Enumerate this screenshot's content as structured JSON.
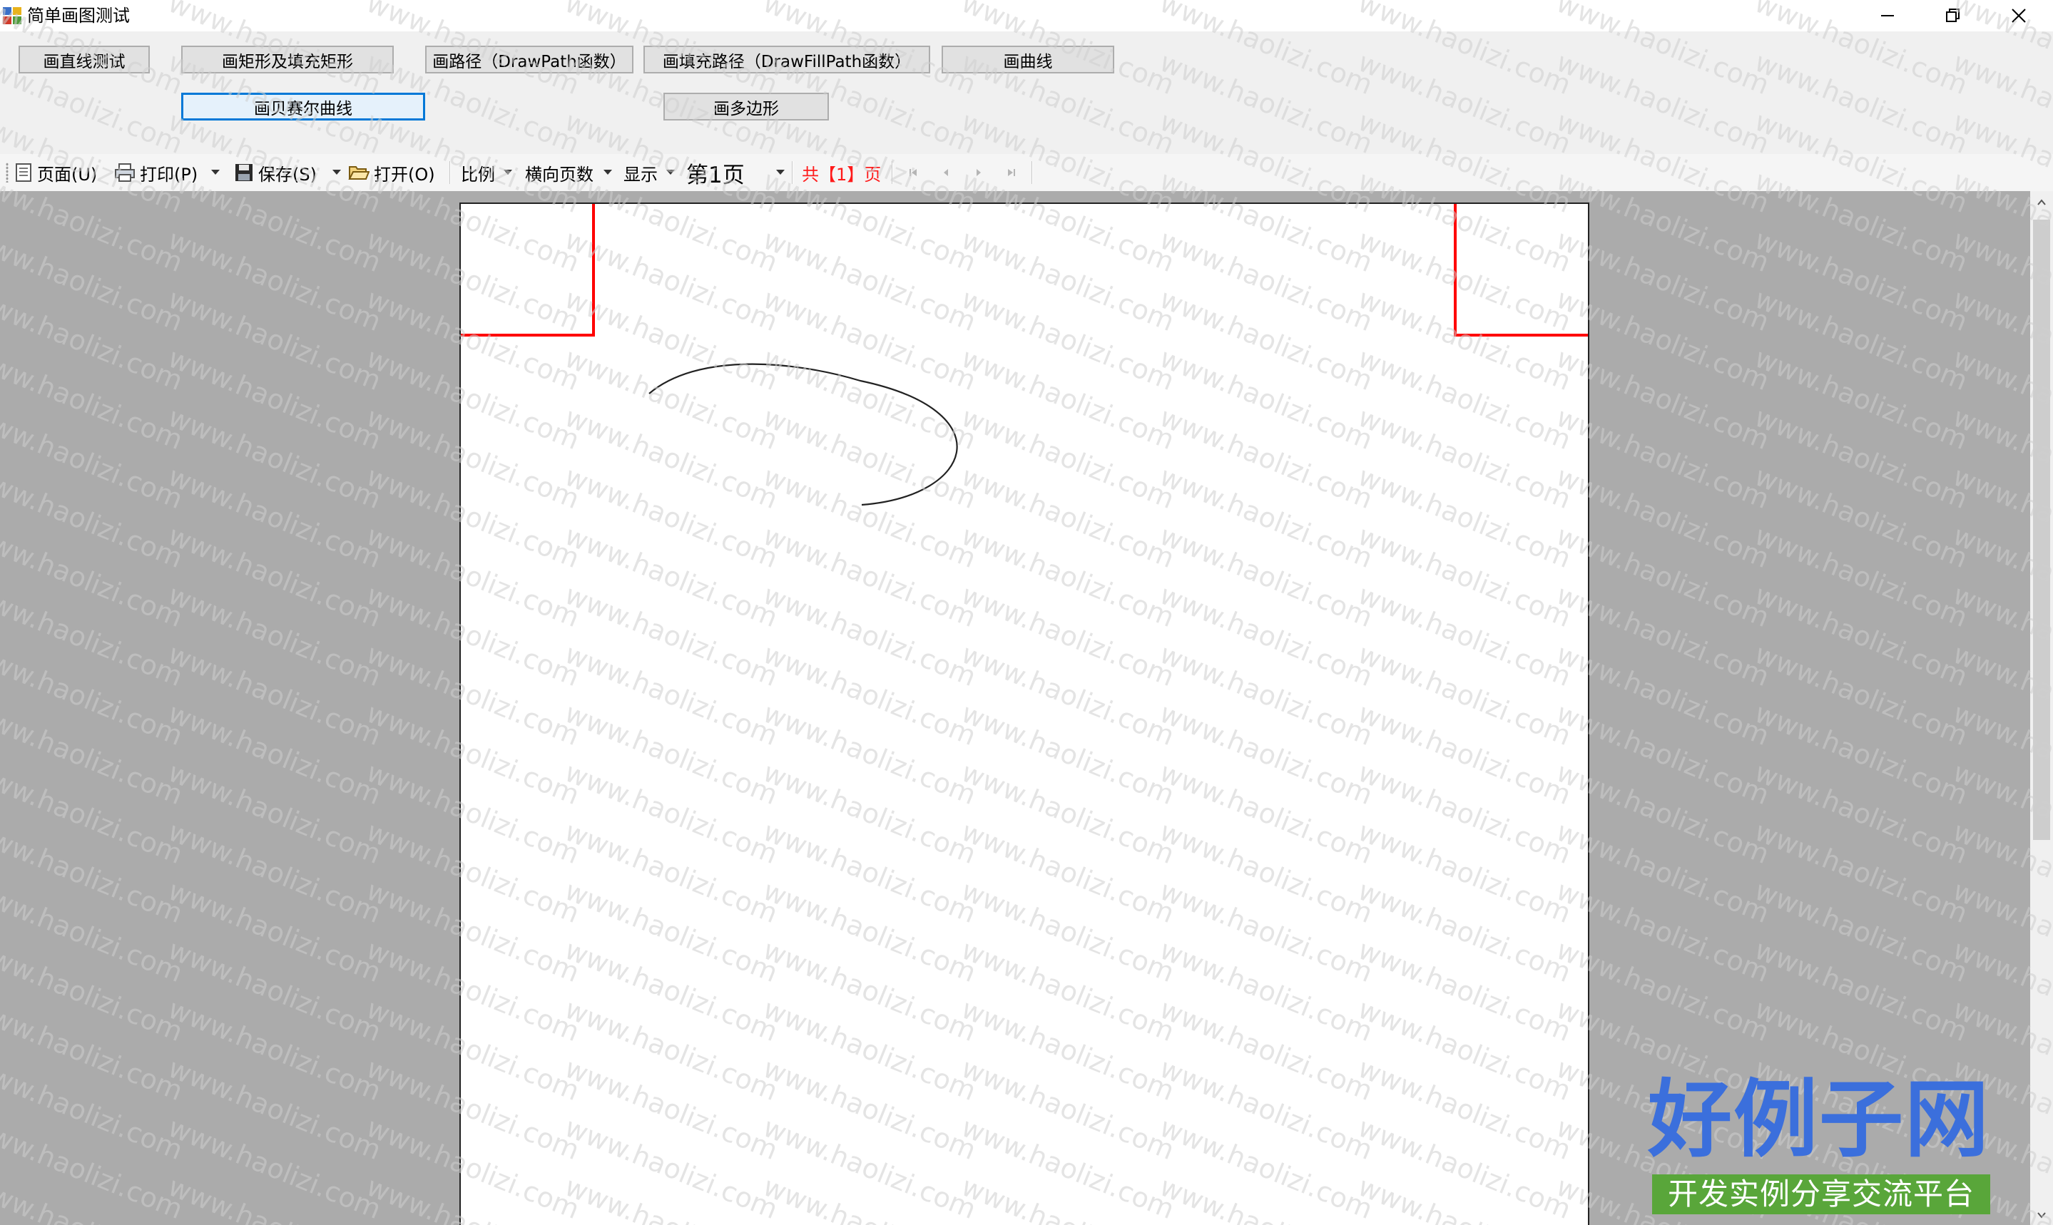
{
  "window": {
    "title": "简单画图测试"
  },
  "buttons": {
    "row1": [
      "画直线测试",
      "画矩形及填充矩形",
      "画路径（DrawPath函数）",
      "画填充路径（DrawFillPath函数）",
      "画曲线"
    ],
    "row2": [
      "画贝赛尔曲线",
      "画多边形"
    ],
    "focused": "画贝赛尔曲线"
  },
  "toolbar": {
    "page_setup": "页面(U)",
    "print": "打印(P)",
    "save": "保存(S)",
    "open": "打开(O)",
    "zoom": "比例",
    "horizontal_pages": "横向页数",
    "display": "显示",
    "current_page": "第1页",
    "total_pages": "共【1】页"
  },
  "watermark": {
    "text": "www.haolizi.com"
  },
  "logo": {
    "title": "好例子网",
    "subtitle": "开发实例分享交流平台"
  },
  "colors": {
    "rect_stroke": "#ff0000",
    "curve_stroke": "#222222",
    "focus_border": "#0078d7",
    "total_pages_text": "#ff1a1a",
    "logo_blue": "#3b6fdc",
    "logo_green": "#59a63a"
  }
}
